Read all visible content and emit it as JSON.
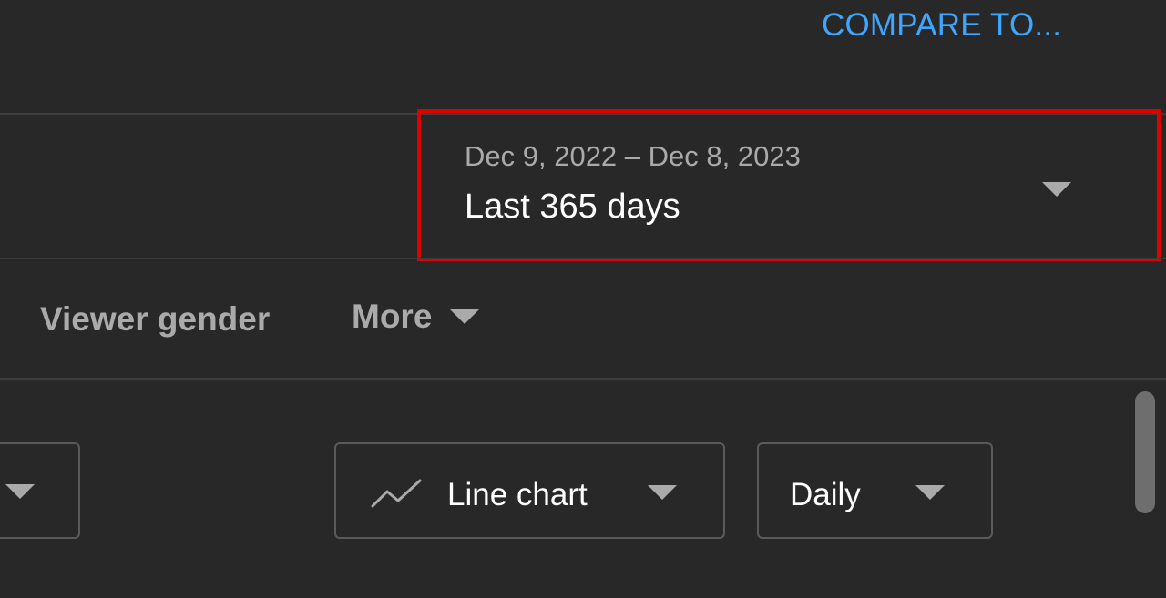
{
  "header": {
    "compare_label": "COMPARE TO..."
  },
  "date_picker": {
    "range": "Dec 9, 2022 – Dec 8, 2023",
    "period": "Last 365 days",
    "highlight_color": "#e00000"
  },
  "tabs": {
    "viewer_gender": "Viewer gender",
    "more": "More"
  },
  "controls": {
    "chart_type": {
      "selected": "Line chart",
      "icon": "line-chart-icon"
    },
    "interval": {
      "selected": "Daily"
    }
  },
  "colors": {
    "background": "#282828",
    "accent": "#3ea6ff",
    "muted_text": "#aaaaaa"
  }
}
